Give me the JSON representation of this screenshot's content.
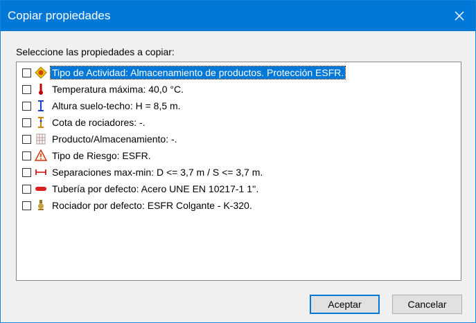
{
  "window": {
    "title": "Copiar propiedades"
  },
  "prompt": "Seleccione las propiedades a copiar:",
  "items": [
    {
      "label": "Tipo de Actividad: Almacenamiento de productos. Protección ESFR.",
      "icon": "activity-warning-icon",
      "checked": false,
      "selected": true
    },
    {
      "label": "Temperatura máxima: 40,0 °C.",
      "icon": "thermometer-icon",
      "checked": false
    },
    {
      "label": "Altura suelo-techo: H = 8,5 m.",
      "icon": "height-measure-icon",
      "checked": false
    },
    {
      "label": "Cota de rociadores: -.",
      "icon": "sprinkler-level-icon",
      "checked": false
    },
    {
      "label": "Producto/Almacenamiento: -.",
      "icon": "storage-rack-icon",
      "checked": false
    },
    {
      "label": "Tipo de Riesgo: ESFR.",
      "icon": "risk-warning-icon",
      "checked": false
    },
    {
      "label": "Separaciones max-min: D <= 3,7 m / S <= 3,7 m.",
      "icon": "spacing-icon",
      "checked": false
    },
    {
      "label": "Tubería por defecto: Acero UNE EN 10217-1 1''.",
      "icon": "pipe-icon",
      "checked": false
    },
    {
      "label": "Rociador por defecto: ESFR Colgante  - K-320.",
      "icon": "sprinkler-head-icon",
      "checked": false
    }
  ],
  "buttons": {
    "ok": "Aceptar",
    "cancel": "Cancelar"
  },
  "colors": {
    "titlebar": "#0078d7",
    "selection": "#0078d7"
  }
}
